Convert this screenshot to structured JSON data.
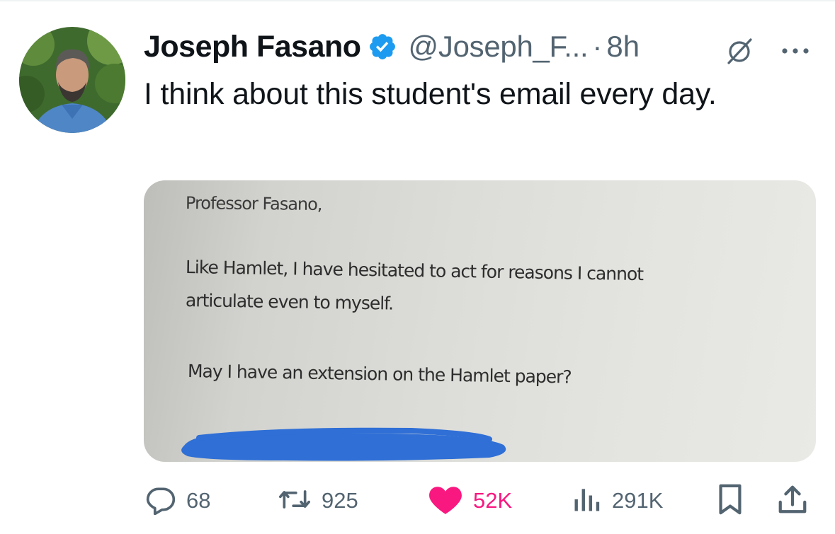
{
  "author": {
    "display_name": "Joseph Fasano",
    "handle": "@Joseph_F...",
    "separator": "·",
    "time": "8h",
    "verified": true,
    "verified_color": "#1d9bf0"
  },
  "tweet": {
    "text": "I think about this student's email every day."
  },
  "media": {
    "salutation": "Professor Fasano,",
    "body_line_1": "Like Hamlet, I have hesitated to act for reasons I cannot",
    "body_line_2": "articulate even to myself.",
    "body_line_3": "May I have an extension on the Hamlet paper?",
    "redaction_color": "#2f6fd6"
  },
  "actions": {
    "replies": "68",
    "reposts": "925",
    "likes": "52K",
    "views": "291K",
    "liked": true,
    "like_color": "#f91880"
  },
  "icons": {
    "verified": "verified-badge-icon",
    "grok": "grok-icon",
    "more": "more-icon",
    "reply": "reply-icon",
    "repost": "repost-icon",
    "like": "heart-icon",
    "views": "views-icon",
    "bookmark": "bookmark-icon",
    "share": "share-icon"
  }
}
